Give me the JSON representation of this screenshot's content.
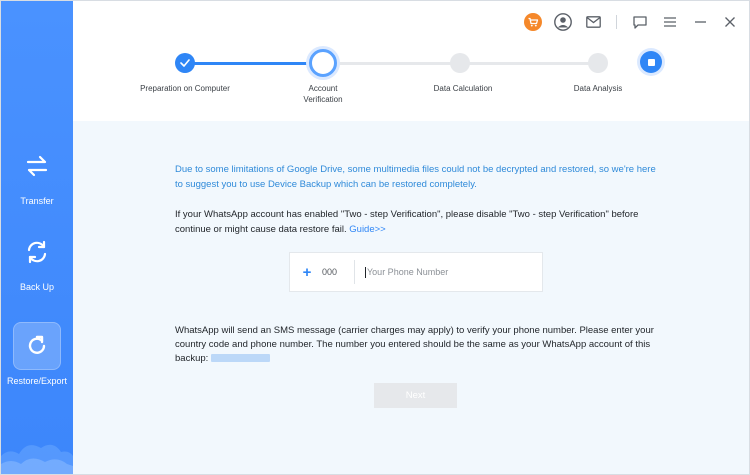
{
  "sidebar": {
    "items": [
      {
        "label": "Transfer",
        "icon": "transfer-icon"
      },
      {
        "label": "Back Up",
        "icon": "backup-icon"
      },
      {
        "label": "Restore/Export",
        "icon": "restore-icon"
      }
    ],
    "active": "Restore/Export"
  },
  "topbar": {
    "icons": [
      "cart-icon",
      "user-icon",
      "mail-icon",
      "feedback-icon",
      "menu-icon",
      "minimize-icon",
      "close-icon"
    ]
  },
  "progress": {
    "steps": [
      {
        "label": "Preparation on Computer",
        "state": "done"
      },
      {
        "label": "Account Verification",
        "state": "current"
      },
      {
        "label": "Data Calculation",
        "state": "pending"
      },
      {
        "label": "Data Analysis",
        "state": "pending"
      }
    ]
  },
  "main": {
    "notice": "Due to some limitations of Google Drive, some multimedia files could not be decrypted and restored, so we're here to suggest you to use Device Backup which can be restored completely.",
    "info": "If your WhatsApp account has enabled \"Two - step Verification\", please disable \"Two - step Verification\" before continue or might cause data restore fail.",
    "guide_link": "Guide>>",
    "phone": {
      "country_code": "000",
      "placeholder": "Your Phone Number",
      "value": ""
    },
    "sms_note": "WhatsApp will send an SMS message (carrier charges may apply) to verify your phone number. Please enter your country code and phone number. The number you entered should be the same as your WhatsApp account of this backup:",
    "next_label": "Next"
  },
  "colors": {
    "accent": "#2f86f6",
    "sidebar": "#3d8bfd",
    "notice_text": "#2f8ad9",
    "content_bg": "#f2f8fd",
    "cart_badge": "#f5882a"
  }
}
